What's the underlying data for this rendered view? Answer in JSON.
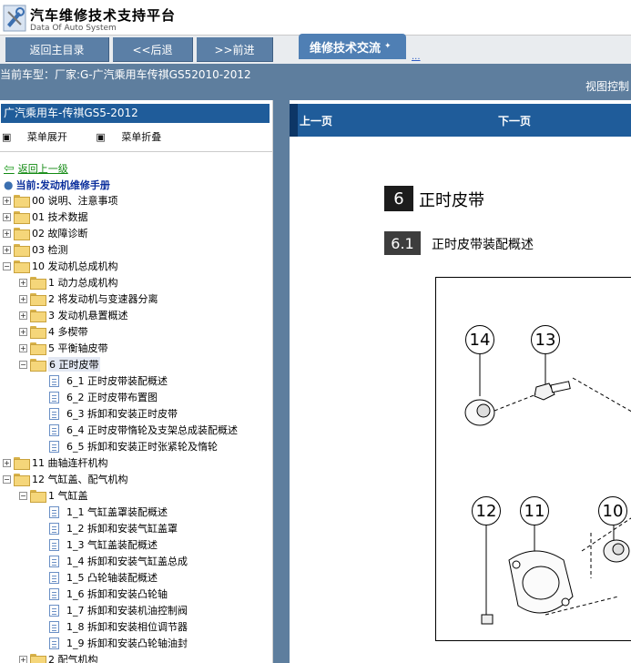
{
  "header": {
    "title": "汽车维修技术支持平台",
    "subtitle": "Data Of Auto System"
  },
  "nav": {
    "home": "返回主目录",
    "back": "<<后退",
    "forward": ">>前进",
    "exchange_tab": "维修技术交流",
    "more": "..."
  },
  "infobar": {
    "current_car": "当前车型：厂家:G-广汽乘用车传祺GS52010-2012",
    "view_control": "视图控制"
  },
  "left": {
    "title": "广汽乘用车-传祺GS5-2012",
    "expand": "菜单展开",
    "collapse": "菜单折叠",
    "back_up": "返回上一级",
    "current": "当前:发动机维修手册",
    "tree": [
      {
        "label": "00 说明、注意事项"
      },
      {
        "label": "01 技术数据"
      },
      {
        "label": "02 故障诊断"
      },
      {
        "label": "03 检测"
      },
      {
        "label": "10 发动机总成机构"
      },
      {
        "label": "1 动力总成机构"
      },
      {
        "label": "2 将发动机与变速器分离"
      },
      {
        "label": "3 发动机悬置概述"
      },
      {
        "label": "4 多楔带"
      },
      {
        "label": "5 平衡轴皮带"
      },
      {
        "label": "6 正时皮带"
      },
      {
        "label": "6_1 正时皮带装配概述"
      },
      {
        "label": "6_2 正时皮带布置图"
      },
      {
        "label": "6_3 拆卸和安装正时皮带"
      },
      {
        "label": "6_4 正时皮带惰轮及支架总成装配概述"
      },
      {
        "label": "6_5 拆卸和安装正时张紧轮及惰轮"
      },
      {
        "label": "11 曲轴连杆机构"
      },
      {
        "label": "12 气缸盖、配气机构"
      },
      {
        "label": "1 气缸盖"
      },
      {
        "label": "1_1 气缸盖罩装配概述"
      },
      {
        "label": "1_2 拆卸和安装气缸盖罩"
      },
      {
        "label": "1_3 气缸盖装配概述"
      },
      {
        "label": "1_4 拆卸和安装气缸盖总成"
      },
      {
        "label": "1_5 凸轮轴装配概述"
      },
      {
        "label": "1_6 拆卸和安装凸轮轴"
      },
      {
        "label": "1_7 拆卸和安装机油控制阀"
      },
      {
        "label": "1_8 拆卸和安装相位调节器"
      },
      {
        "label": "1_9 拆卸和安装凸轮轴油封"
      },
      {
        "label": "2 配气机构"
      }
    ]
  },
  "right": {
    "prev": "上一页",
    "next": "下一页",
    "section_number": "6",
    "section_title": "正时皮带",
    "subsection_number": "6.1",
    "subsection_title": "正时皮带装配概述",
    "callouts": [
      "14",
      "13",
      "12",
      "11",
      "10"
    ]
  }
}
